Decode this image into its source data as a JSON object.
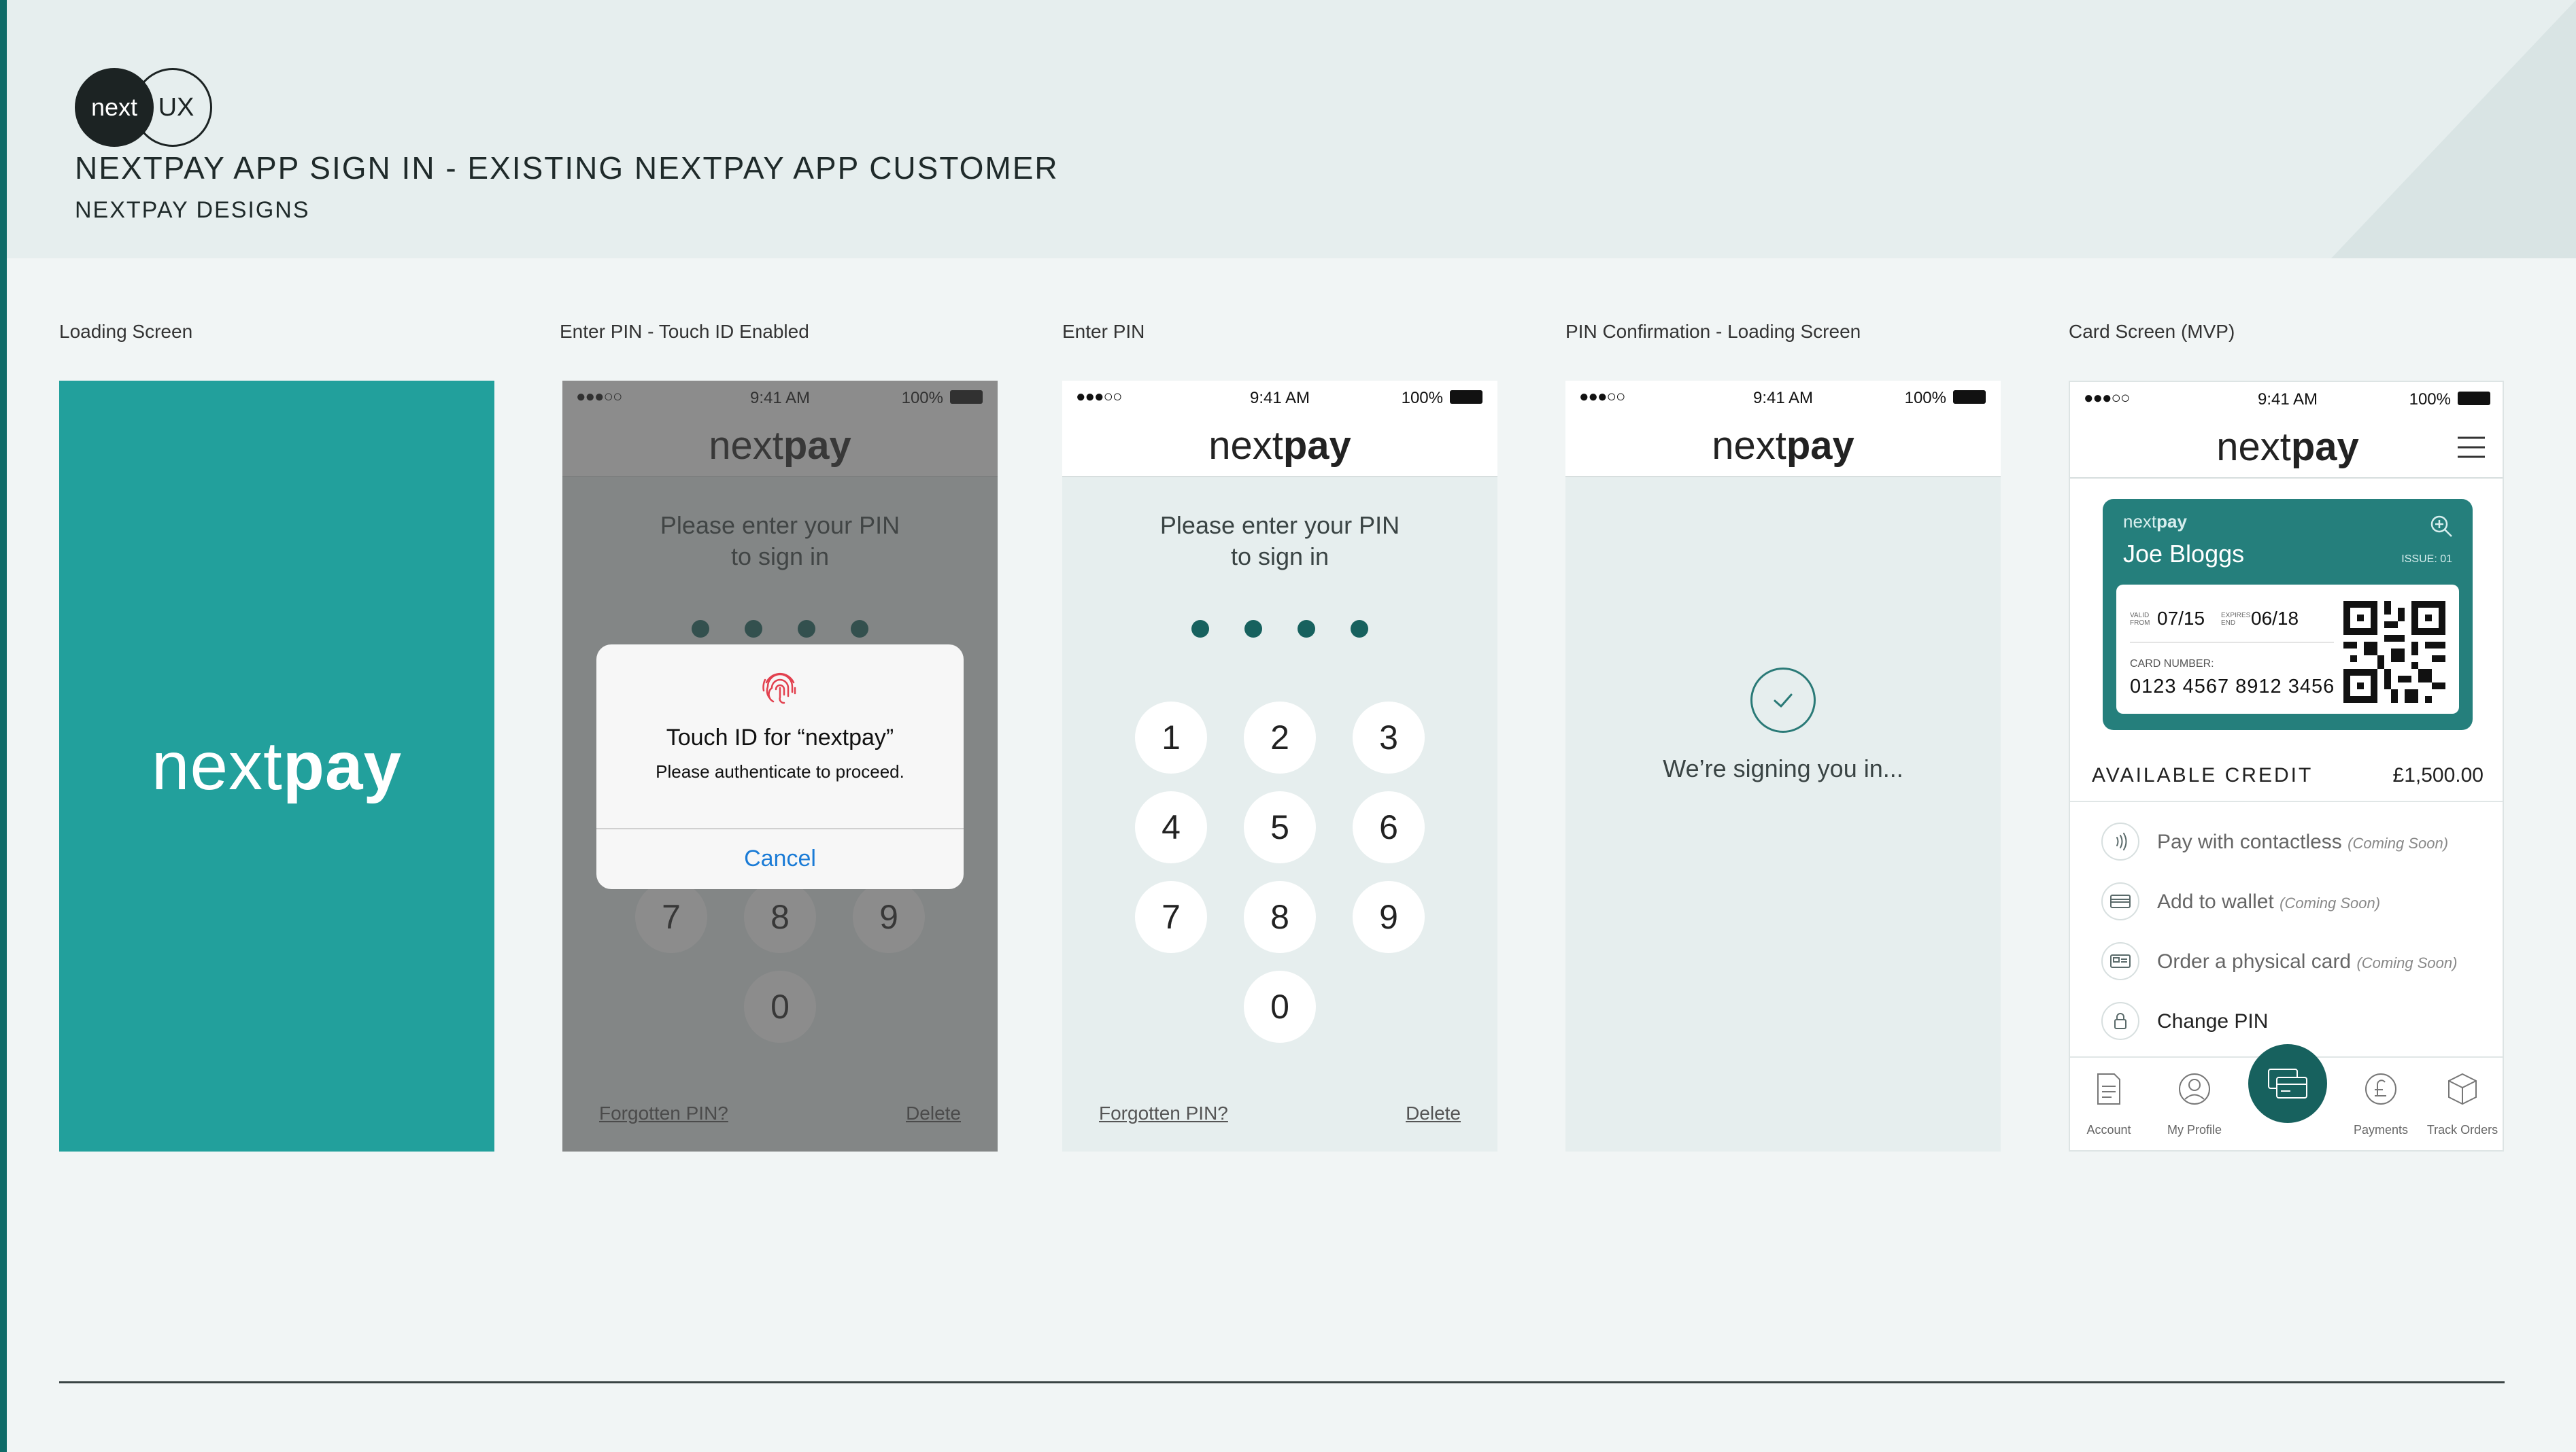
{
  "doc": {
    "logo_left": "next",
    "logo_right": "UX",
    "title": "NEXTPAY APP SIGN IN - EXISTING NEXTPAY APP CUSTOMER",
    "subtitle": "NEXTPAY DESIGNS"
  },
  "brand": {
    "light": "next",
    "bold": "pay"
  },
  "status": {
    "carrier": "●●●○○",
    "time": "9:41 AM",
    "battery": "100%"
  },
  "screens": [
    {
      "label": "Loading Screen"
    },
    {
      "label": "Enter PIN - Touch ID Enabled"
    },
    {
      "label": "Enter PIN"
    },
    {
      "label": "PIN Confirmation - Loading Screen"
    },
    {
      "label": "Card Screen (MVP)"
    }
  ],
  "pin": {
    "prompt_line1": "Please enter your PIN",
    "prompt_line2": "to sign in",
    "keys": [
      "1",
      "2",
      "3",
      "4",
      "5",
      "6",
      "7",
      "8",
      "9",
      "0"
    ],
    "forgot": "Forgotten PIN?",
    "delete": "Delete"
  },
  "touch_id": {
    "title": "Touch ID for “nextpay”",
    "message": "Please authenticate to proceed.",
    "cancel": "Cancel"
  },
  "signing": {
    "text": "We’re signing you in..."
  },
  "card_screen": {
    "card_brand_light": "next",
    "card_brand_bold": "pay",
    "name": "Joe Bloggs",
    "issue": "ISSUE: 01",
    "valid_from_label": "VALID FROM",
    "valid_from": "07/15",
    "expires_label": "EXPIRES END",
    "expires": "06/18",
    "card_number_label": "CARD NUMBER:",
    "card_number": "0123 4567 8912 3456",
    "credit_label": "AVAILABLE CREDIT",
    "credit_value": "£1,500.00",
    "menu": [
      {
        "label": "Pay with contactless",
        "soon": "(Coming Soon)",
        "icon": "contactless-icon"
      },
      {
        "label": "Add to wallet",
        "soon": "(Coming Soon)",
        "icon": "wallet-icon"
      },
      {
        "label": "Order a physical card",
        "soon": "(Coming Soon)",
        "icon": "card-icon"
      },
      {
        "label": "Change PIN",
        "soon": "",
        "icon": "lock-icon"
      }
    ],
    "tabs": [
      {
        "label": "Account",
        "icon": "document-icon"
      },
      {
        "label": "My Profile",
        "icon": "profile-icon"
      },
      {
        "label": "",
        "icon": "card-center-icon"
      },
      {
        "label": "Payments",
        "icon": "pound-icon"
      },
      {
        "label": "Track Orders",
        "icon": "box-icon"
      }
    ]
  },
  "colors": {
    "teal": "#22a09c",
    "dark_teal": "#17615e",
    "card_teal": "#257f7c",
    "link_blue": "#1a7bd6"
  }
}
